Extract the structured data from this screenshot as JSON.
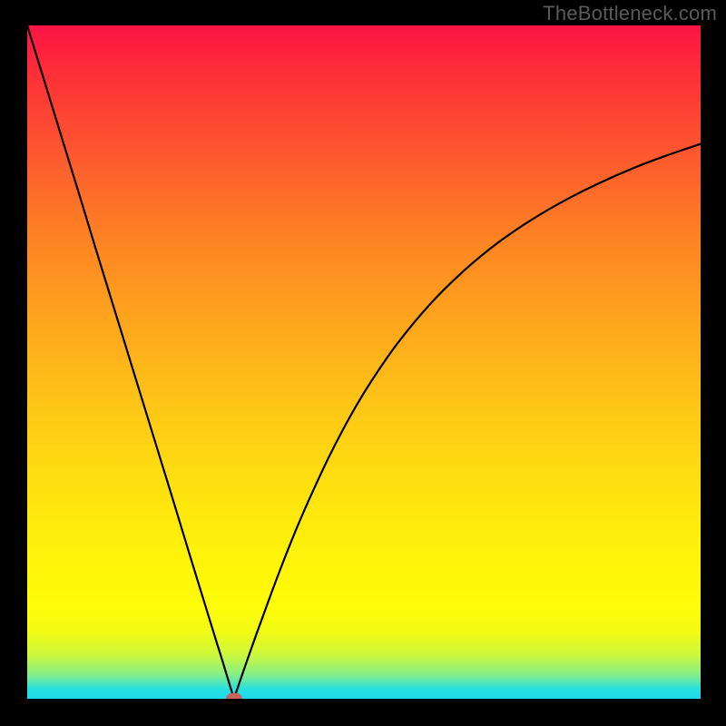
{
  "watermark": "TheBottleneck.com",
  "chart_data": {
    "type": "line",
    "title": "",
    "xlabel": "",
    "ylabel": "",
    "x_range": [
      0,
      100
    ],
    "y_range": [
      0,
      100
    ],
    "grid": false,
    "legend": false,
    "gradient_stops": [
      {
        "pos": 0,
        "color": "#fc1444"
      },
      {
        "pos": 8,
        "color": "#fd3237"
      },
      {
        "pos": 20,
        "color": "#fd5b2e"
      },
      {
        "pos": 32,
        "color": "#fe8423"
      },
      {
        "pos": 45,
        "color": "#fea81c"
      },
      {
        "pos": 57,
        "color": "#fec716"
      },
      {
        "pos": 68,
        "color": "#fee010"
      },
      {
        "pos": 78,
        "color": "#fff20b"
      },
      {
        "pos": 86,
        "color": "#fffc08"
      },
      {
        "pos": 90,
        "color": "#f2fb13"
      },
      {
        "pos": 93.5,
        "color": "#ccf83d"
      },
      {
        "pos": 96.5,
        "color": "#83ee8b"
      },
      {
        "pos": 98.5,
        "color": "#28e0de"
      },
      {
        "pos": 100,
        "color": "#1adbec"
      }
    ],
    "series": [
      {
        "name": "left-branch",
        "x": [
          0.0,
          2.0,
          4.0,
          6.0,
          8.0,
          10.0,
          12.0,
          14.0,
          16.0,
          18.0,
          20.0,
          22.0,
          24.0,
          26.0,
          28.0,
          29.0,
          30.0,
          30.7
        ],
        "y": [
          100.0,
          93.5,
          87.0,
          80.5,
          74.0,
          67.4,
          60.9,
          54.4,
          47.9,
          41.4,
          34.9,
          28.4,
          21.8,
          15.3,
          8.8,
          5.6,
          2.3,
          0.0
        ]
      },
      {
        "name": "right-branch",
        "x": [
          30.7,
          32.0,
          34.0,
          36.0,
          38.0,
          40.0,
          42.5,
          45.0,
          48.0,
          51.0,
          55.0,
          60.0,
          65.0,
          70.0,
          75.0,
          80.0,
          85.0,
          90.0,
          95.0,
          100.0
        ],
        "y": [
          0.0,
          3.8,
          9.5,
          15.0,
          20.3,
          25.3,
          31.0,
          36.3,
          42.0,
          47.0,
          52.8,
          58.8,
          63.7,
          67.8,
          71.2,
          74.1,
          76.6,
          78.8,
          80.7,
          82.4
        ]
      }
    ],
    "marker": {
      "x": 30.7,
      "y": 0.0,
      "color": "#c8645d"
    }
  }
}
